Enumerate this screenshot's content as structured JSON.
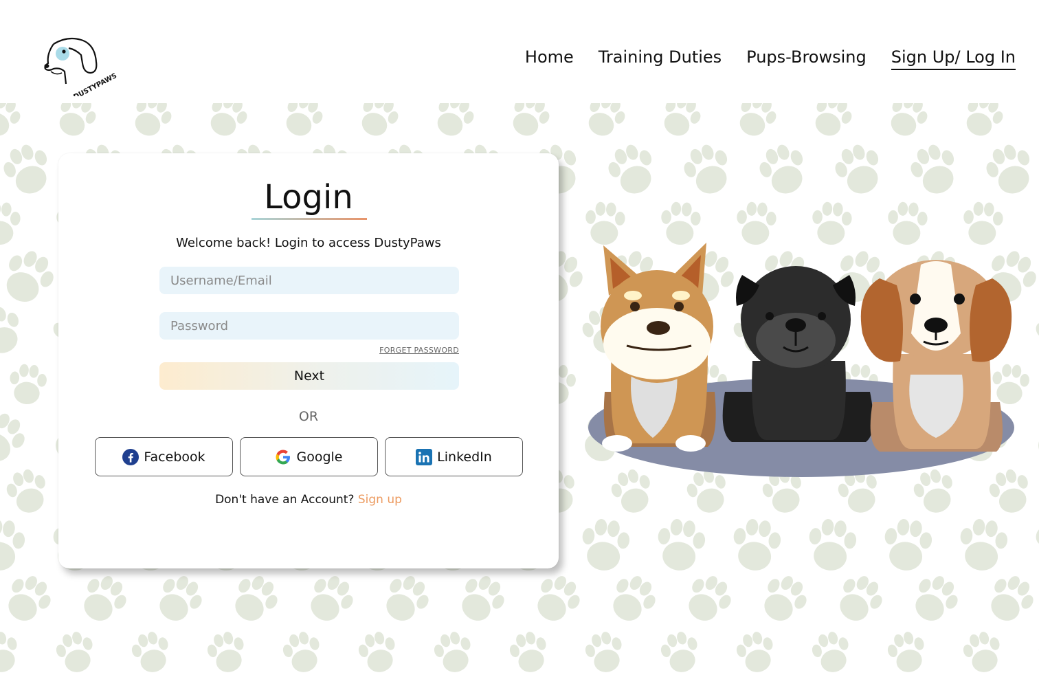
{
  "brand": {
    "name": "DUSTYPAWS"
  },
  "nav": {
    "items": [
      {
        "label": "Home"
      },
      {
        "label": "Training Duties"
      },
      {
        "label": "Pups-Browsing"
      },
      {
        "label": "Sign Up/ Log In",
        "active": true
      }
    ]
  },
  "login": {
    "title": "Login",
    "subtitle": "Welcome back! Login to access DustyPaws",
    "username_placeholder": "Username/Email",
    "password_placeholder": "Password",
    "forget_password": "FORGET PASSWORD",
    "next_label": "Next",
    "or_label": "OR",
    "social": [
      {
        "label": "Facebook",
        "icon": "facebook-icon"
      },
      {
        "label": "Google",
        "icon": "google-icon"
      },
      {
        "label": "LinkedIn",
        "icon": "linkedin-icon"
      }
    ],
    "signup_prompt": "Don't have an Account?",
    "signup_link": "Sign up"
  },
  "colors": {
    "accent_orange": "#ec9a5f",
    "input_bg": "#e9f4fa",
    "paw_pattern": "#e3e8dc"
  }
}
